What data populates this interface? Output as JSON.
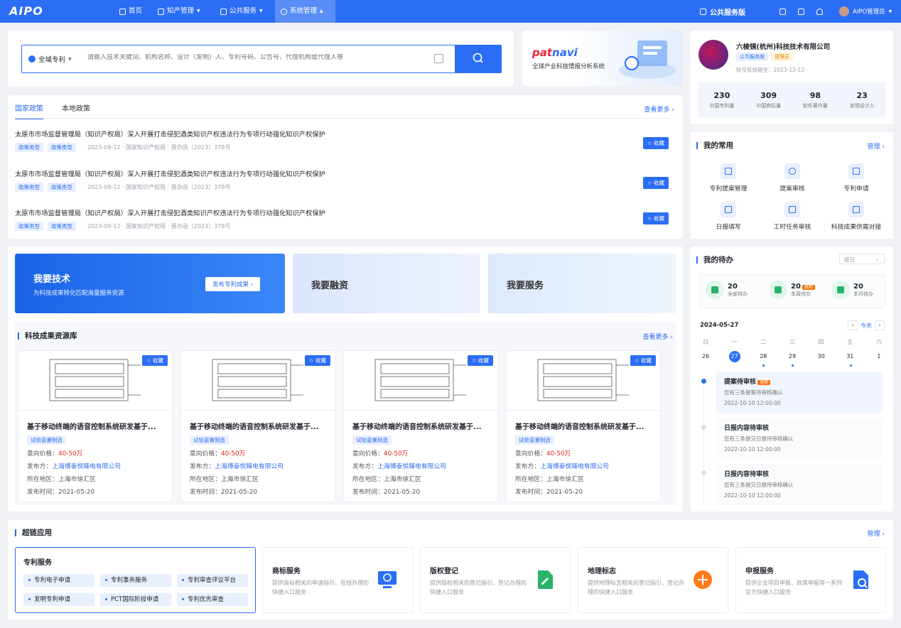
{
  "nav": {
    "logo": "AIPO",
    "items": [
      {
        "label": "首页",
        "icon": "home-icon"
      },
      {
        "label": "知产管理",
        "icon": "doc-icon"
      },
      {
        "label": "公共服务",
        "icon": "monitor-icon"
      },
      {
        "label": "系统管理",
        "icon": "settings-icon"
      }
    ],
    "public_service": "公共服务版",
    "user": "AIPO管理员"
  },
  "search": {
    "scope": "全域专利",
    "placeholder": "请输入技术关键词、机构名称、设计（发明）人、专利号码、公告号、代理机构或代理人等"
  },
  "patnavi": {
    "logo_a": "pat",
    "logo_b": "navi",
    "subtitle": "全球产业科技情报分析系统"
  },
  "policy": {
    "tabs": [
      "国家政策",
      "本地政策"
    ],
    "more": "查看更多",
    "collect": "收藏",
    "rows": [
      {
        "title": "太原市市场监督管理局（知识产权局）深入开展打击侵犯酒类知识产权违法行为专项行动强化知识产权保护",
        "tags": [
          "政策类型",
          "政策类型"
        ],
        "meta": "2023-09-12 · 国家知识产权局 · 晋办函〔2023〕378号"
      },
      {
        "title": "太原市市场监督管理局（知识产权局）深入开展打击侵犯酒类知识产权违法行为专项行动强化知识产权保护",
        "tags": [
          "政策类型",
          "政策类型"
        ],
        "meta": "2023-09-12 · 国家知识产权局 · 晋办函〔2023〕378号"
      },
      {
        "title": "太原市市场监督管理局（知识产权局）深入开展打击侵犯酒类知识产权违法行为专项行动强化知识产权保护",
        "tags": [
          "政策类型",
          "政策类型"
        ],
        "meta": "2023-09-12 · 国家知识产权局 · 晋办函〔2023〕378号"
      }
    ]
  },
  "banners": {
    "tech": {
      "title": "我要技术",
      "subtitle": "为科技成果转化匹配海量服务资源",
      "button": "发布专利成果"
    },
    "finance": {
      "title": "我要融资"
    },
    "service": {
      "title": "我要服务"
    }
  },
  "resources": {
    "title": "科技成果资源库",
    "more": "查看更多",
    "collect": "收藏",
    "price_label": "意向价格：",
    "publisher_label": "发布方：",
    "region_label": "所在地区：",
    "time_label": "发布时间：",
    "items": [
      {
        "title": "基于移动终端的语音控制系统研发基于...",
        "tag": "试验装置制造",
        "price": "40-50万",
        "publisher": "上海博泰悦臻电有限公司",
        "region": "上海市徐汇区",
        "time": "2021-05-20"
      },
      {
        "title": "基于移动终端的语音控制系统研发基于...",
        "tag": "试验装置制造",
        "price": "40-50万",
        "publisher": "上海博泰悦臻电有限公司",
        "region": "上海市徐汇区",
        "time": "2021-05-20"
      },
      {
        "title": "基于移动终端的语音控制系统研发基于...",
        "tag": "试验装置制造",
        "price": "40-50万",
        "publisher": "上海博泰悦臻电有限公司",
        "region": "上海市徐汇区",
        "time": "2021-05-20"
      },
      {
        "title": "基于移动终端的语音控制系统研发基于...",
        "tag": "试验装置制造",
        "price": "40-50万",
        "publisher": "上海博泰悦臻电有限公司",
        "region": "上海市徐汇区",
        "time": "2021-05-20"
      }
    ]
  },
  "company": {
    "name": "六棱镜(杭州)科技技术有限公司",
    "tag1": "公共服务版",
    "tag2": "管理员",
    "expiry": "账号有效期至：2023-12-12",
    "stats": [
      {
        "value": "230",
        "label": "中国专利量"
      },
      {
        "value": "309",
        "label": "中国商标量"
      },
      {
        "value": "98",
        "label": "软件著作量"
      },
      {
        "value": "23",
        "label": "发明设计人"
      }
    ]
  },
  "common": {
    "title": "我的常用",
    "manage": "管理",
    "items": [
      "专利提案管理",
      "提案审核",
      "专利申请",
      "日报填写",
      "工时任务审核",
      "科技成果供需对接"
    ]
  },
  "todo": {
    "title": "我的待办",
    "select": "按日",
    "stats": [
      {
        "value": "20",
        "label": "全部待办",
        "badge": ""
      },
      {
        "value": "20",
        "label": "本周待办",
        "badge": "逾期"
      },
      {
        "value": "20",
        "label": "本月待办",
        "badge": ""
      }
    ],
    "date": "2024-05-27",
    "today": "今天",
    "weekdays": [
      "日",
      "一",
      "二",
      "三",
      "四",
      "五",
      "六"
    ],
    "days": [
      "26",
      "27",
      "28",
      "29",
      "30",
      "31",
      "1"
    ],
    "items": [
      {
        "title": "提案待审核",
        "badge": "逾期",
        "sub": "您有三条提案待审核确认",
        "time": "2022-10-10 12:00:00"
      },
      {
        "title": "日报内容待审核",
        "badge": "",
        "sub": "您有三条提交日报待审核确认",
        "time": "2022-10-10 12:00:00"
      },
      {
        "title": "日报内容待审核",
        "badge": "",
        "sub": "您有三条提交日报待审核确认",
        "time": "2022-10-10 12:00:00"
      }
    ]
  },
  "links": {
    "title": "超链应用",
    "manage": "管理",
    "patent": {
      "title": "专利服务",
      "chips": [
        "专利电子申请",
        "专利事务服务",
        "专利审查评议平台",
        "发明专利申请",
        "PCT国际阶段申请",
        "专利优先审查"
      ]
    },
    "services": [
      {
        "title": "商标服务",
        "desc": "提供商标相关的申请指引、在线办理的快捷入口服务",
        "icon": "trademark-icon",
        "color": "#2b6df5"
      },
      {
        "title": "版权登记",
        "desc": "提供版权相关的登记指引、登记办理的快捷入口服务",
        "icon": "copyright-icon",
        "color": "#27b36a"
      },
      {
        "title": "地理标志",
        "desc": "提供地理标志相关的登记指引、登记办理的快捷入口服务",
        "icon": "geo-mark-icon",
        "color": "#ff7a1a"
      },
      {
        "title": "申报服务",
        "desc": "提供企业项目申报、政策申报等一系列官方快捷入口服务",
        "icon": "declare-icon",
        "color": "#2b6df5"
      }
    ]
  }
}
